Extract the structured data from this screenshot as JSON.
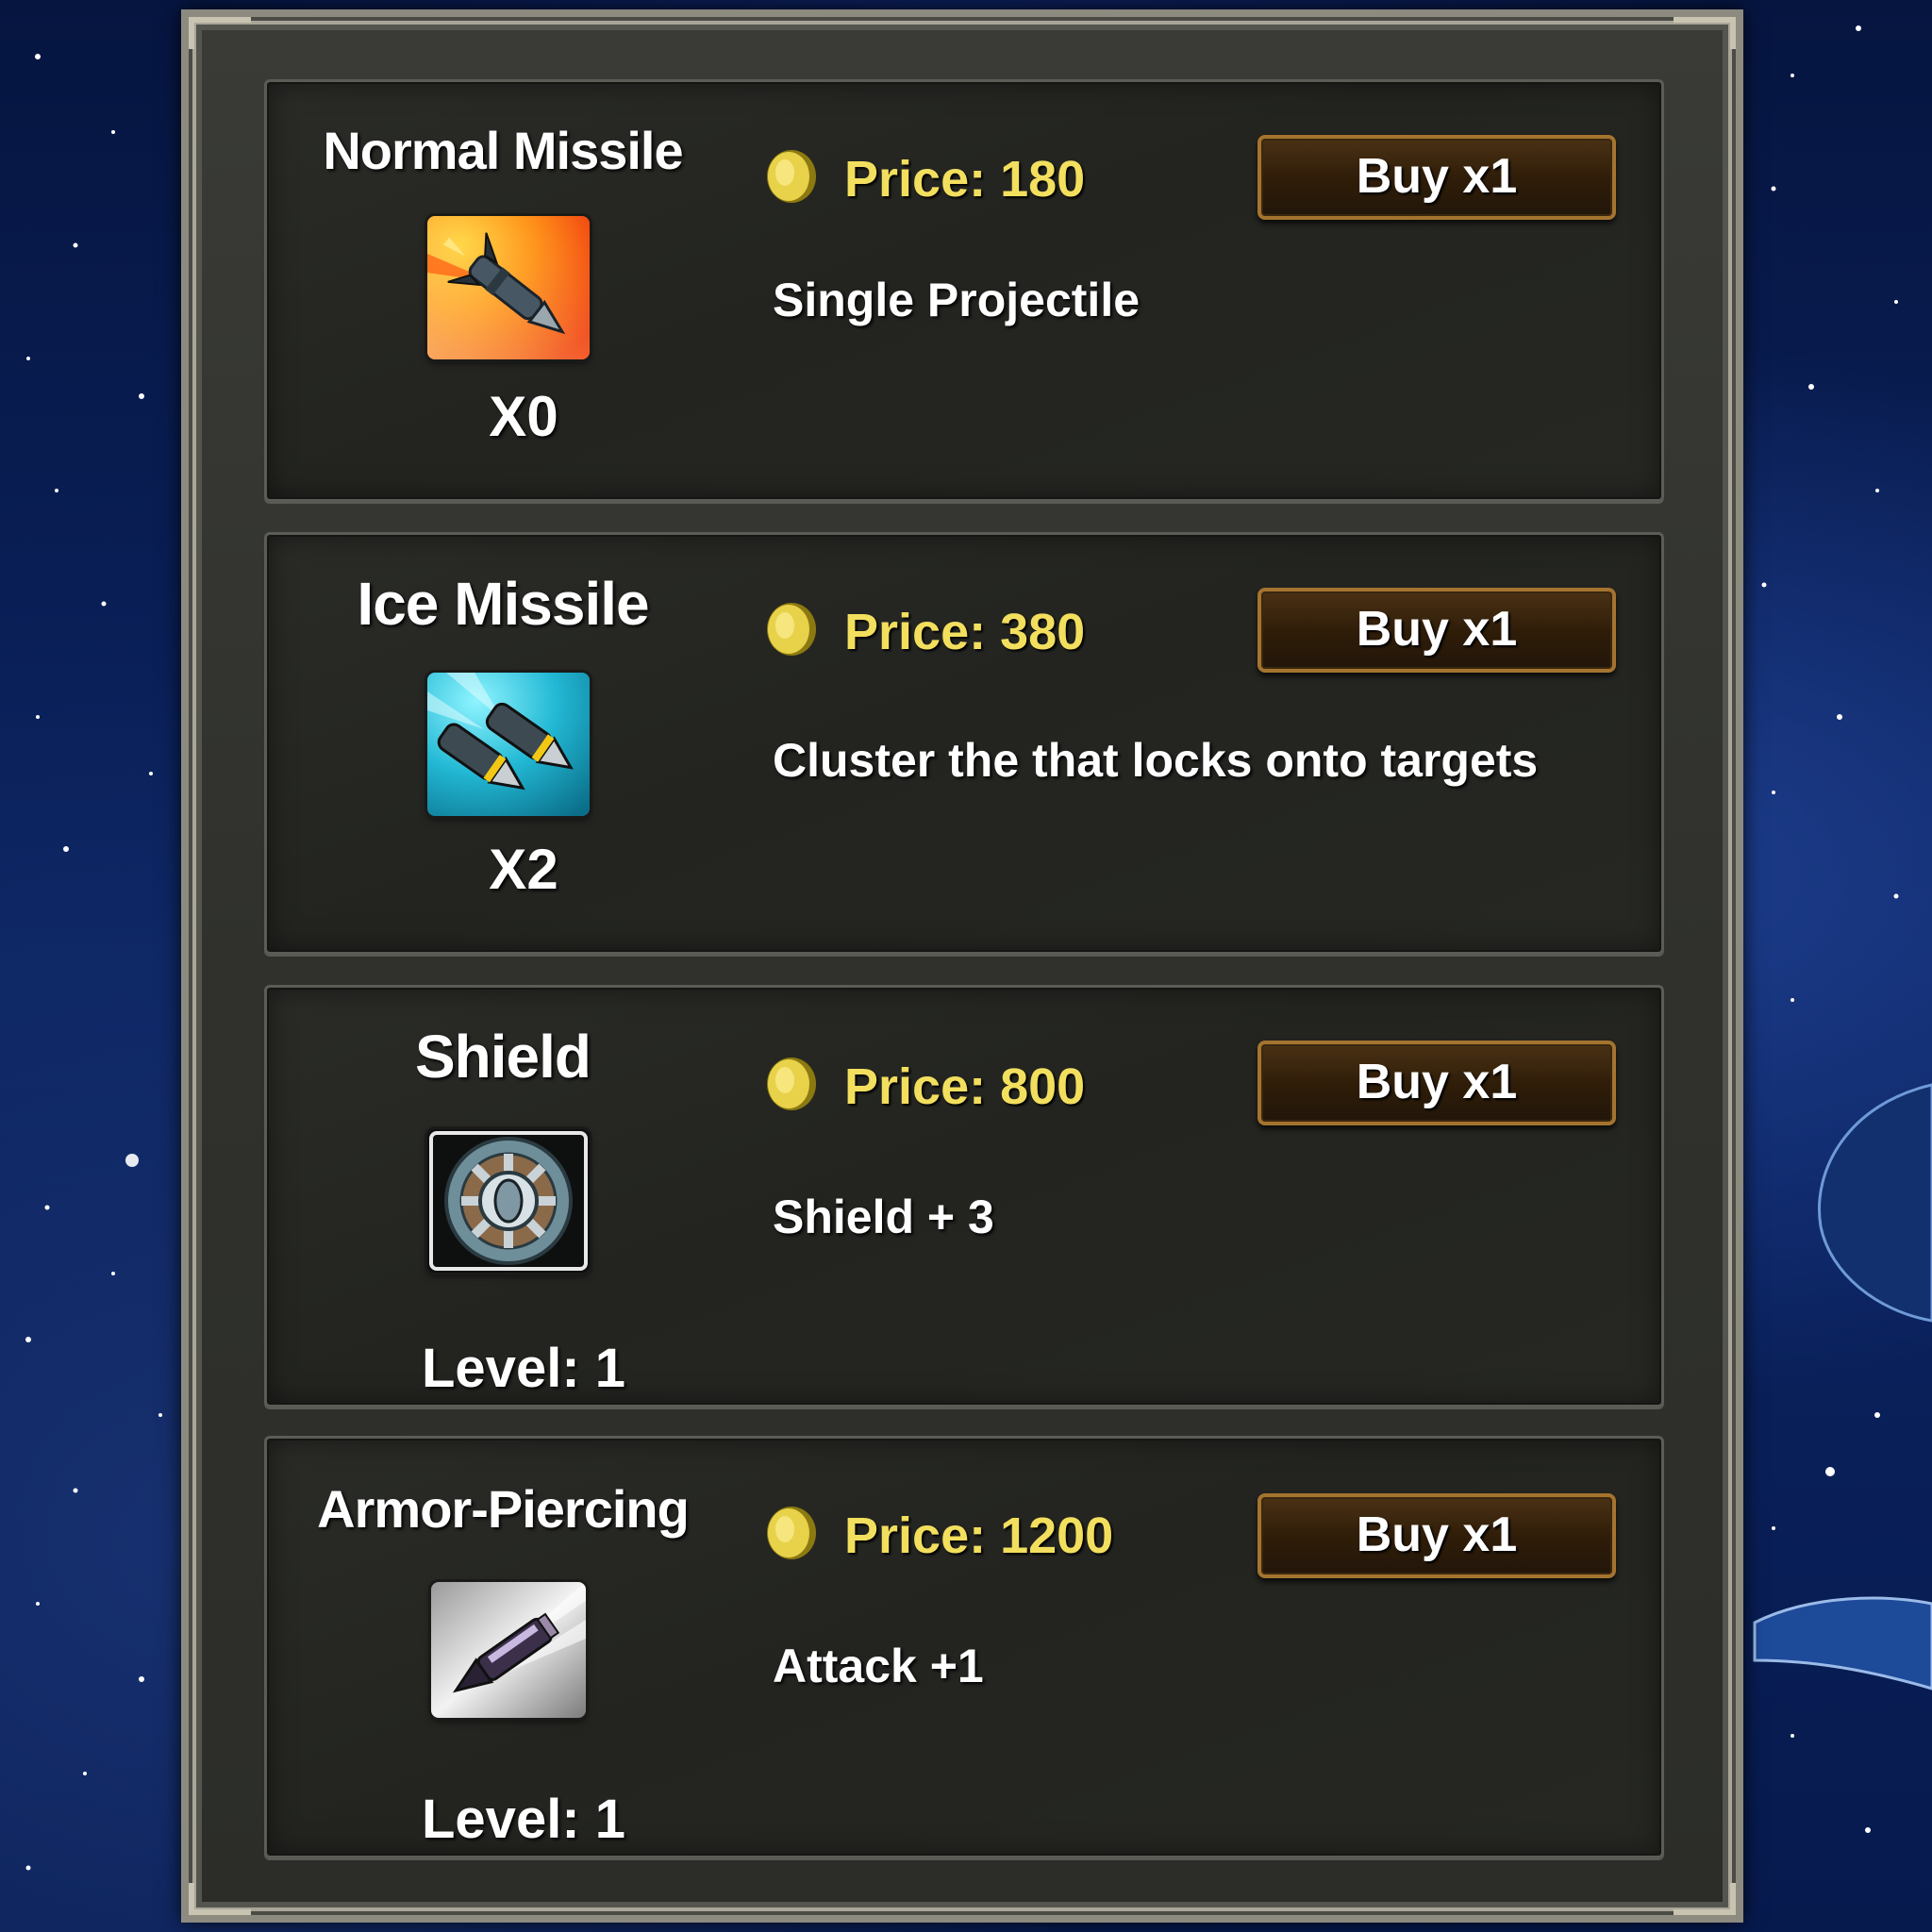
{
  "shop": {
    "items": [
      {
        "name": "Normal Missile",
        "icon": "missile-fire-icon",
        "price": "Price: 180",
        "buy_label": "Buy x1",
        "description": "Single Projectile",
        "count": "X0"
      },
      {
        "name": "Ice Missile",
        "icon": "missile-ice-icon",
        "price": "Price: 380",
        "buy_label": "Buy x1",
        "description": "Cluster the that locks onto targets",
        "count": "X2"
      },
      {
        "name": "Shield",
        "icon": "shield-icon",
        "price": "Price: 800",
        "buy_label": "Buy x1",
        "description": "Shield + 3",
        "count": "Level: 1"
      },
      {
        "name": "Armor-Piercing",
        "icon": "armor-piercing-bullet-icon",
        "price": "Price: 1200",
        "buy_label": "Buy x1",
        "description": "Attack +1",
        "count": "Level: 1"
      }
    ]
  },
  "colors": {
    "price_text": "#f3df5e",
    "button_border": "#a4742e",
    "panel_bg": "#30312d",
    "space_bg": "#0b2462"
  }
}
